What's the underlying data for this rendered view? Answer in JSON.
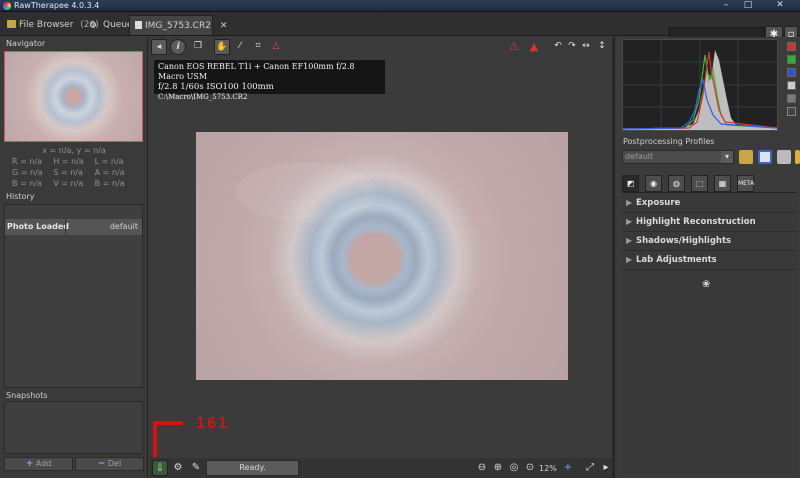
{
  "window": {
    "title": "RawTherapee 4.0.3.4",
    "minimize_glyph": "–",
    "maximize_glyph": "□",
    "close_glyph": "✕"
  },
  "tabs": {
    "file_browser": {
      "label": "File Browser",
      "count": "(26)"
    },
    "queue": {
      "label": "Queue"
    },
    "editor": {
      "label": "IMG_5753.CR2",
      "close": "✕"
    }
  },
  "navigator": {
    "title": "Navigator",
    "coords": "x = n/a, y = n/a",
    "values": [
      [
        "R = n/a",
        "H = n/a",
        "L = n/a"
      ],
      [
        "G = n/a",
        "S = n/a",
        "A = n/a"
      ],
      [
        "B = n/a",
        "V = n/a",
        "B = n/a"
      ]
    ]
  },
  "history": {
    "title": "History",
    "rows": [
      {
        "name": "Photo Loaded",
        "value": "default"
      }
    ]
  },
  "snapshots": {
    "title": "Snapshots",
    "add_label": "Add",
    "del_label": "Del"
  },
  "exif": {
    "line1": "Canon EOS REBEL T1i + Canon EF100mm f/2.8 Macro USM",
    "line2": "f/2.8  1/60s  ISO100  100mm",
    "line3": "C:\\Macro\\IMG_5753.CR2"
  },
  "annotation": {
    "text": "161"
  },
  "status": {
    "ready": "Ready.",
    "zoom": "12%"
  },
  "right": {
    "profiles_label": "Postprocessing Profiles",
    "profile_value": "default",
    "sections": [
      "Exposure",
      "Highlight Reconstruction",
      "Shadows/Highlights",
      "Lab Adjustments"
    ],
    "tool_tabs": [
      "exposure-tab",
      "detail-tab",
      "color-tab",
      "transform-tab",
      "raw-tab",
      "metadata-tab"
    ],
    "meta_tab_label": "META",
    "ornament": "❀"
  },
  "colors": {
    "accent_red": "#d21414",
    "histo_red": "#e03030",
    "histo_green": "#30c030",
    "histo_blue": "#3060f0"
  }
}
